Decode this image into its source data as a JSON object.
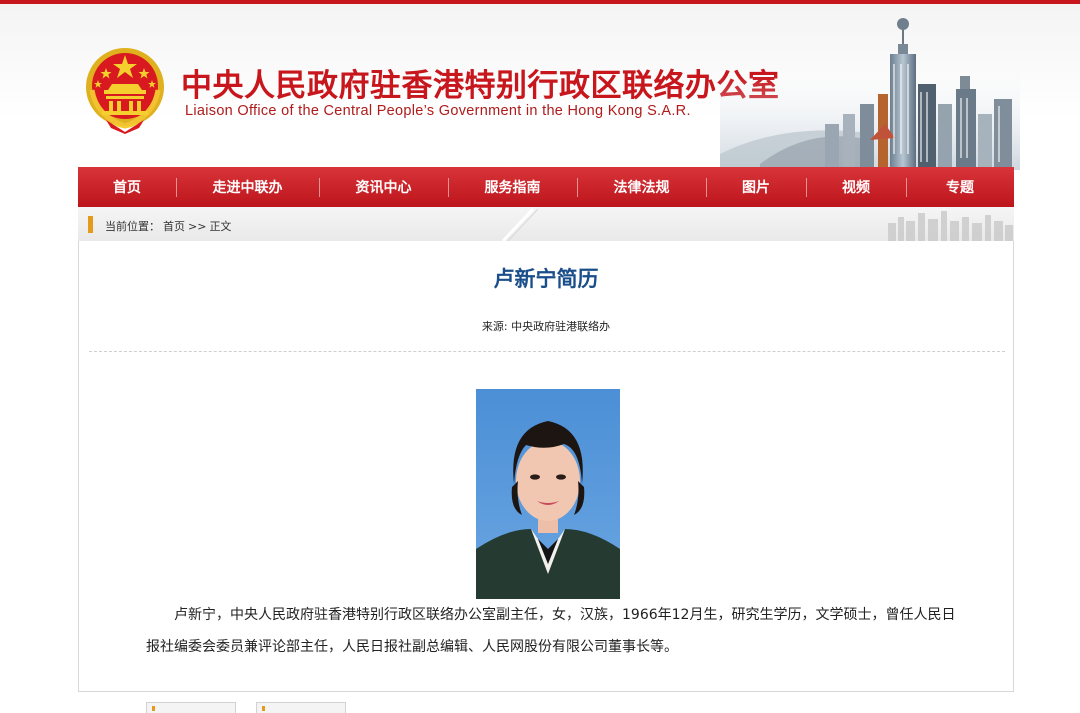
{
  "header": {
    "title_cn": "中央人民政府驻香港特别行政区联络办公室",
    "title_en": "Liaison Office of the Central People’s Government in the Hong Kong S.A.R."
  },
  "nav": {
    "items": [
      {
        "label": "首页"
      },
      {
        "label": "走进中联办"
      },
      {
        "label": "资讯中心"
      },
      {
        "label": "服务指南"
      },
      {
        "label": "法律法规"
      },
      {
        "label": "图片"
      },
      {
        "label": "视频"
      },
      {
        "label": "专题"
      }
    ]
  },
  "breadcrumb": {
    "prefix": "当前位置：",
    "home": "首页",
    "separator": ">>",
    "current": "正文"
  },
  "article": {
    "title": "卢新宁简历",
    "source": "来源: 中央政府驻港联络办",
    "body": "卢新宁，中央人民政府驻香港特别行政区联络办公室副主任，女，汉族，1966年12月生，研究生学历，文学硕士，曾任人民日报社编委会委员兼评论部主任，人民日报社副总编辑、人民网股份有限公司董事长等。"
  },
  "colors": {
    "brand_red": "#c8161d",
    "title_blue": "#1a4e8a",
    "accent_orange": "#e69a1b"
  },
  "icons": {
    "emblem": "national-emblem-icon",
    "crumb_marker": "breadcrumb-marker-icon"
  }
}
